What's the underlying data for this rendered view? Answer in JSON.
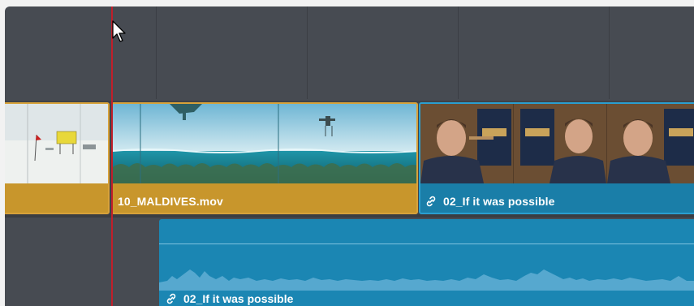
{
  "timeline": {
    "video_track": {
      "clips": [
        {
          "label": "",
          "color": "#c8962c",
          "content": "snowy field with yellow sign and red flag"
        },
        {
          "label": "10_MALDIVES.mov",
          "color": "#c8962c",
          "content": "seaplane over ocean with coral reef"
        },
        {
          "label": "02_If it was possible",
          "color": "#1a7ea8",
          "linked": true,
          "icon": "link-icon"
        }
      ]
    },
    "audio_track": {
      "clips": [
        {
          "label": "02_If it was possible",
          "color": "#1b86b3",
          "linked": true,
          "icon": "link-icon"
        }
      ]
    },
    "playhead_color": "#c01f2a",
    "cursor": "arrow-cursor-icon"
  }
}
